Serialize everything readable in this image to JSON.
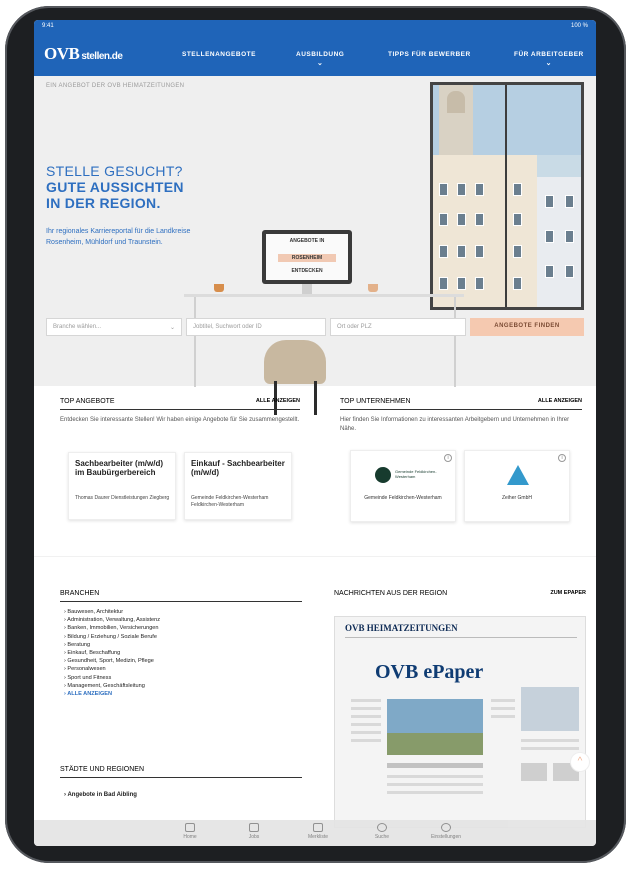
{
  "status_bar": {
    "time": "9:41",
    "battery": "100 %"
  },
  "header": {
    "logo_main": "OVB",
    "logo_sub": "stellen.de",
    "nav": [
      "STELLENANGEBOTE",
      "AUSBILDUNG",
      "TIPPS FÜR BEWERBER",
      "FÜR ARBEITGEBER"
    ]
  },
  "hero": {
    "breadcrumb": "EIN ANGEBOT DER OVB HEIMATZEITUNGEN",
    "headline_line1": "STELLE GESUCHT?",
    "headline_line2": "GUTE AUSSICHTEN",
    "headline_line3": "IN DER REGION.",
    "intro": "Ihr regionales Karriereportal für die Landkreise Rosenheim, Mühldorf und Traunstein.",
    "monitor_line1": "ANGEBOTE IN",
    "monitor_line2": "ROSENHEIM",
    "monitor_line3": "ENTDECKEN",
    "search": {
      "branch_placeholder": "Branche wählen...",
      "keyword_placeholder": "Jobtitel, Suchwort oder ID",
      "location_placeholder": "Ort oder PLZ",
      "button": "ANGEBOTE FINDEN"
    }
  },
  "top_offers": {
    "title": "TOP ANGEBOTE",
    "link": "ALLE ANZEIGEN",
    "desc": "Entdecken Sie interessante Stellen! Wir haben einige Angebote für Sie zusammengestellt.",
    "cards": [
      {
        "title": "Sachbearbeiter (m/w/d) im Baubürgerbereich",
        "sub": "Thomas Daurer Dienstleistungen Ziegberg"
      },
      {
        "title": "Einkauf - Sachbearbeiter (m/w/d)",
        "sub": "Gemeinde Feldkirchen-Westerham Feldkirchen-Westerham"
      }
    ]
  },
  "top_companies": {
    "title": "TOP UNTERNEHMEN",
    "link": "ALLE ANZEIGEN",
    "desc": "Hier finden Sie Informationen zu interessanten Arbeitgebern und Unternehmen in Ihrer Nähe.",
    "cards": [
      {
        "name": "Gemeinde Feldkirchen-Westerham",
        "logo_text": "Gemeinde Feldkirchen-Westerham"
      },
      {
        "name": "Zeiher GmbH",
        "logo_text": ""
      }
    ]
  },
  "branches": {
    "title": "BRANCHEN",
    "items": [
      "Bauwesen, Architektur",
      "Administration, Verwaltung, Assistenz",
      "Banken, Immobilien, Versicherungen",
      "Bildung / Erziehung / Soziale Berufe",
      "Beratung",
      "Einkauf, Beschaffung",
      "Gesundheit, Sport, Medizin, Pflege",
      "Personalwesen",
      "Sport und Fitness",
      "Management, Geschäftsleitung"
    ],
    "more": "ALLE ANZEIGEN"
  },
  "regions": {
    "title": "STÄDTE UND REGIONEN",
    "first_item": "Angebote in Bad Aibling"
  },
  "news": {
    "title": "NACHRICHTEN AUS DER REGION",
    "link": "ZUM EPAPER",
    "epaper_header": "OVB HEIMATZEITUNGEN",
    "epaper_title": "OVB ePaper"
  },
  "tabbar": [
    "Home",
    "Jobs",
    "Merkliste",
    "Suche",
    "Einstellungen"
  ],
  "colors": {
    "brand_blue": "#1f64b8",
    "accent_peach": "#f5c9b0"
  }
}
